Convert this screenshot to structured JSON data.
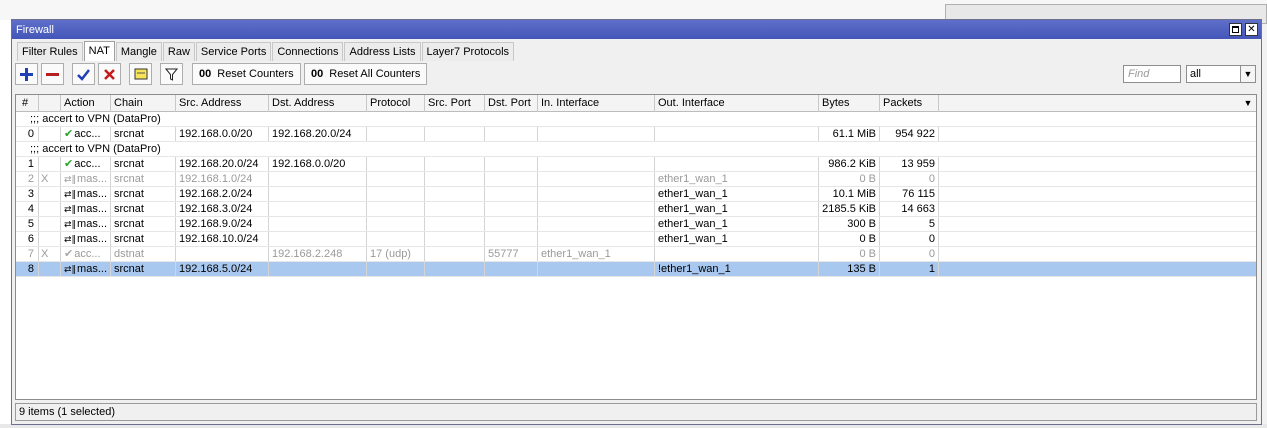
{
  "window": {
    "title": "Firewall"
  },
  "tabs": [
    {
      "label": "Filter Rules",
      "active": false
    },
    {
      "label": "NAT",
      "active": true
    },
    {
      "label": "Mangle",
      "active": false
    },
    {
      "label": "Raw",
      "active": false
    },
    {
      "label": "Service Ports",
      "active": false
    },
    {
      "label": "Connections",
      "active": false
    },
    {
      "label": "Address Lists",
      "active": false
    },
    {
      "label": "Layer7 Protocols",
      "active": false
    }
  ],
  "toolbar": {
    "reset_counters_icon": "00",
    "reset_counters": "Reset Counters",
    "reset_all_counters_icon": "00",
    "reset_all_counters": "Reset All Counters",
    "find_placeholder": "Find",
    "filter_value": "all"
  },
  "columns": [
    "#",
    "",
    "Action",
    "Chain",
    "Src. Address",
    "Dst. Address",
    "Protocol",
    "Src. Port",
    "Dst. Port",
    "In. Interface",
    "Out. Interface",
    "Bytes",
    "Packets"
  ],
  "rows": [
    {
      "type": "comment",
      "text": ";;; accert to VPN (DataPro)"
    },
    {
      "type": "rule",
      "idx": "0",
      "flag": "",
      "icon": "check",
      "action": "acc...",
      "chain": "srcnat",
      "src": "192.168.0.0/20",
      "dst": "192.168.20.0/24",
      "proto": "",
      "sport": "",
      "dport": "",
      "in": "",
      "out": "",
      "bytes": "61.1 MiB",
      "packets": "954 922",
      "disabled": false,
      "selected": false
    },
    {
      "type": "comment",
      "text": ";;; accert to VPN (DataPro)"
    },
    {
      "type": "rule",
      "idx": "1",
      "flag": "",
      "icon": "check",
      "action": "acc...",
      "chain": "srcnat",
      "src": "192.168.20.0/24",
      "dst": "192.168.0.0/20",
      "proto": "",
      "sport": "",
      "dport": "",
      "in": "",
      "out": "",
      "bytes": "986.2 KiB",
      "packets": "13 959",
      "disabled": false,
      "selected": false
    },
    {
      "type": "rule",
      "idx": "2",
      "flag": "X",
      "icon": "masq",
      "action": "mas...",
      "chain": "srcnat",
      "src": "192.168.1.0/24",
      "dst": "",
      "proto": "",
      "sport": "",
      "dport": "",
      "in": "",
      "out": "ether1_wan_1",
      "bytes": "0 B",
      "packets": "0",
      "disabled": true,
      "selected": false
    },
    {
      "type": "rule",
      "idx": "3",
      "flag": "",
      "icon": "masq",
      "action": "mas...",
      "chain": "srcnat",
      "src": "192.168.2.0/24",
      "dst": "",
      "proto": "",
      "sport": "",
      "dport": "",
      "in": "",
      "out": "ether1_wan_1",
      "bytes": "10.1 MiB",
      "packets": "76 115",
      "disabled": false,
      "selected": false
    },
    {
      "type": "rule",
      "idx": "4",
      "flag": "",
      "icon": "masq",
      "action": "mas...",
      "chain": "srcnat",
      "src": "192.168.3.0/24",
      "dst": "",
      "proto": "",
      "sport": "",
      "dport": "",
      "in": "",
      "out": "ether1_wan_1",
      "bytes": "2185.5 KiB",
      "packets": "14 663",
      "disabled": false,
      "selected": false
    },
    {
      "type": "rule",
      "idx": "5",
      "flag": "",
      "icon": "masq",
      "action": "mas...",
      "chain": "srcnat",
      "src": "192.168.9.0/24",
      "dst": "",
      "proto": "",
      "sport": "",
      "dport": "",
      "in": "",
      "out": "ether1_wan_1",
      "bytes": "300 B",
      "packets": "5",
      "disabled": false,
      "selected": false
    },
    {
      "type": "rule",
      "idx": "6",
      "flag": "",
      "icon": "masq",
      "action": "mas...",
      "chain": "srcnat",
      "src": "192.168.10.0/24",
      "dst": "",
      "proto": "",
      "sport": "",
      "dport": "",
      "in": "",
      "out": "ether1_wan_1",
      "bytes": "0 B",
      "packets": "0",
      "disabled": false,
      "selected": false
    },
    {
      "type": "rule",
      "idx": "7",
      "flag": "X",
      "icon": "check",
      "action": "acc...",
      "chain": "dstnat",
      "src": "",
      "dst": "192.168.2.248",
      "proto": "17 (udp)",
      "sport": "",
      "dport": "55777",
      "in": "ether1_wan_1",
      "out": "",
      "bytes": "0 B",
      "packets": "0",
      "disabled": true,
      "selected": false
    },
    {
      "type": "rule",
      "idx": "8",
      "flag": "",
      "icon": "masq",
      "action": "mas...",
      "chain": "srcnat",
      "src": "192.168.5.0/24",
      "dst": "",
      "proto": "",
      "sport": "",
      "dport": "",
      "in": "",
      "out": "!ether1_wan_1",
      "bytes": "135 B",
      "packets": "1",
      "disabled": false,
      "selected": true
    }
  ],
  "status": {
    "text": "9 items (1 selected)"
  }
}
